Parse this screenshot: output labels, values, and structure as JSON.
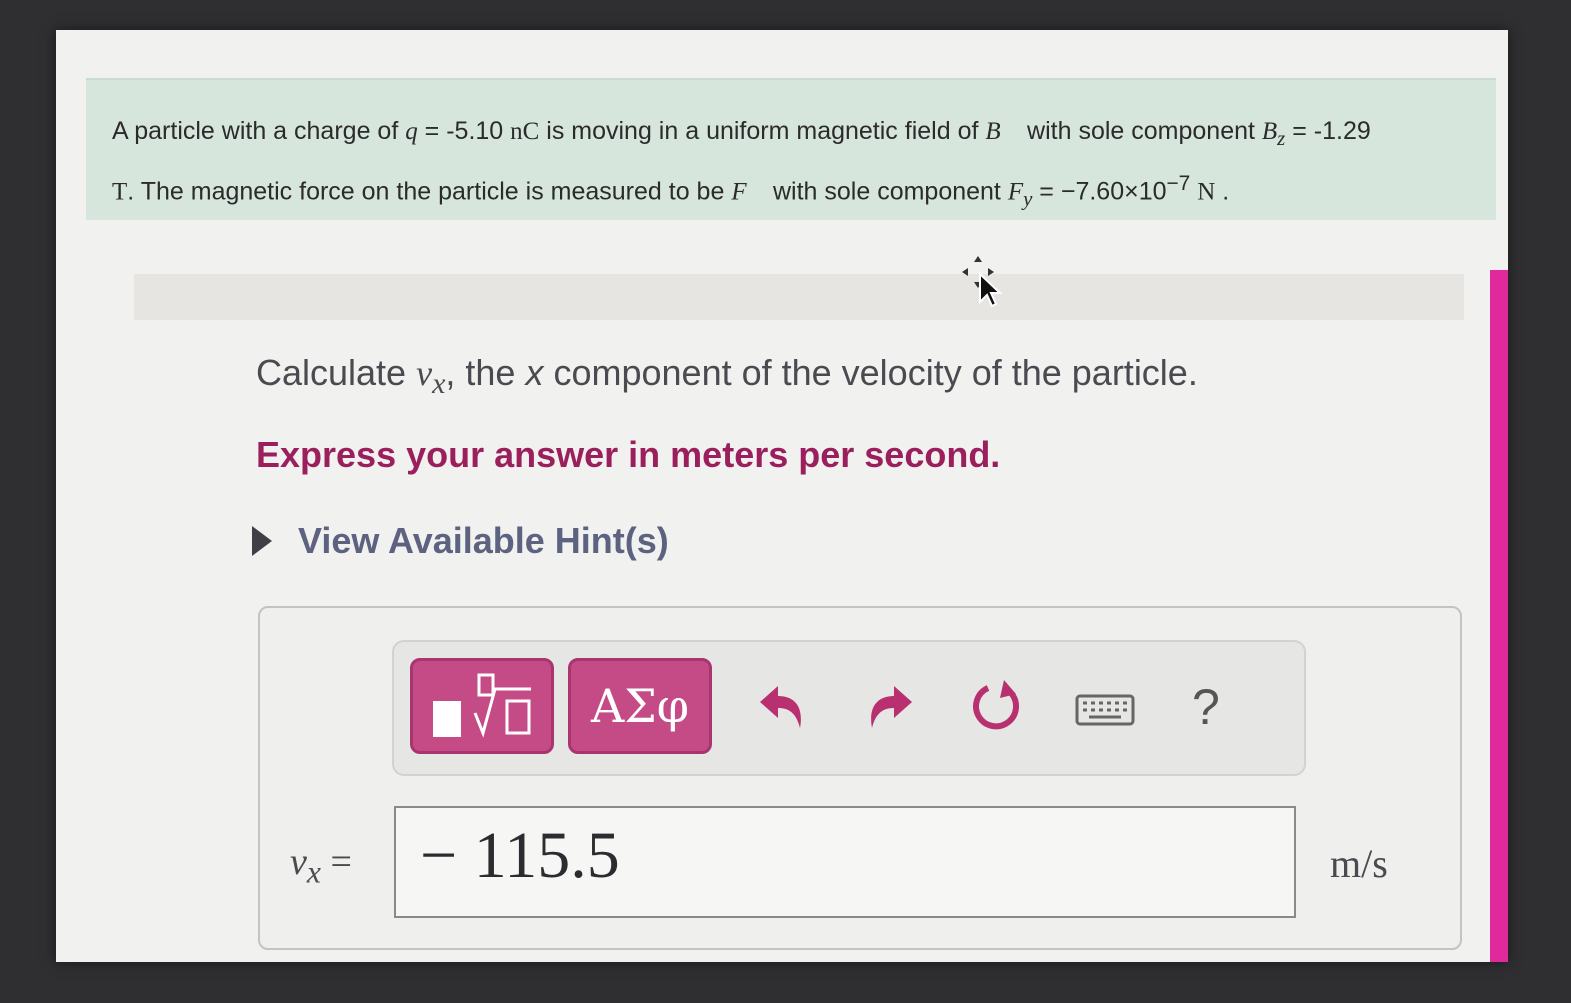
{
  "problem": {
    "t1": "A particle with a charge of ",
    "q_sym": "q",
    "t2": " = -5.10 ",
    "q_unit": "nC",
    "t3": " is moving in a uniform magnetic field of ",
    "B_vec": "B⃗",
    "t4": " with sole component ",
    "Bz_sym": "B",
    "Bz_sub": "z",
    "t5": " = -1.29",
    "B_unit": "T",
    "t6": ". The magnetic force on the particle is measured to be ",
    "F_vec": "F⃗",
    "t7": " with sole component ",
    "Fy_sym": "F",
    "Fy_sub": "y",
    "t8": " = −7.60×10",
    "exp": "−7",
    "F_unit": "N",
    "t9": " ."
  },
  "question": {
    "t1": "Calculate ",
    "v": "v",
    "sub": "x",
    "t2": ", the ",
    "xi": "x",
    "t3": " component of the velocity of the particle."
  },
  "instruction": "Express your answer in meters per second.",
  "hint_label": "View Available Hint(s)",
  "toolbar": {
    "symbols_label": "ΑΣφ",
    "help_label": "?"
  },
  "answer": {
    "var": "v",
    "var_sub": "x",
    "eq": " =",
    "value": "− 115.5",
    "unit": "m/s"
  },
  "colors": {
    "accent": "#c54b87",
    "instruction": "#9a1f5c",
    "hint": "#5c6280",
    "problem_bg": "#d7e6dd"
  }
}
